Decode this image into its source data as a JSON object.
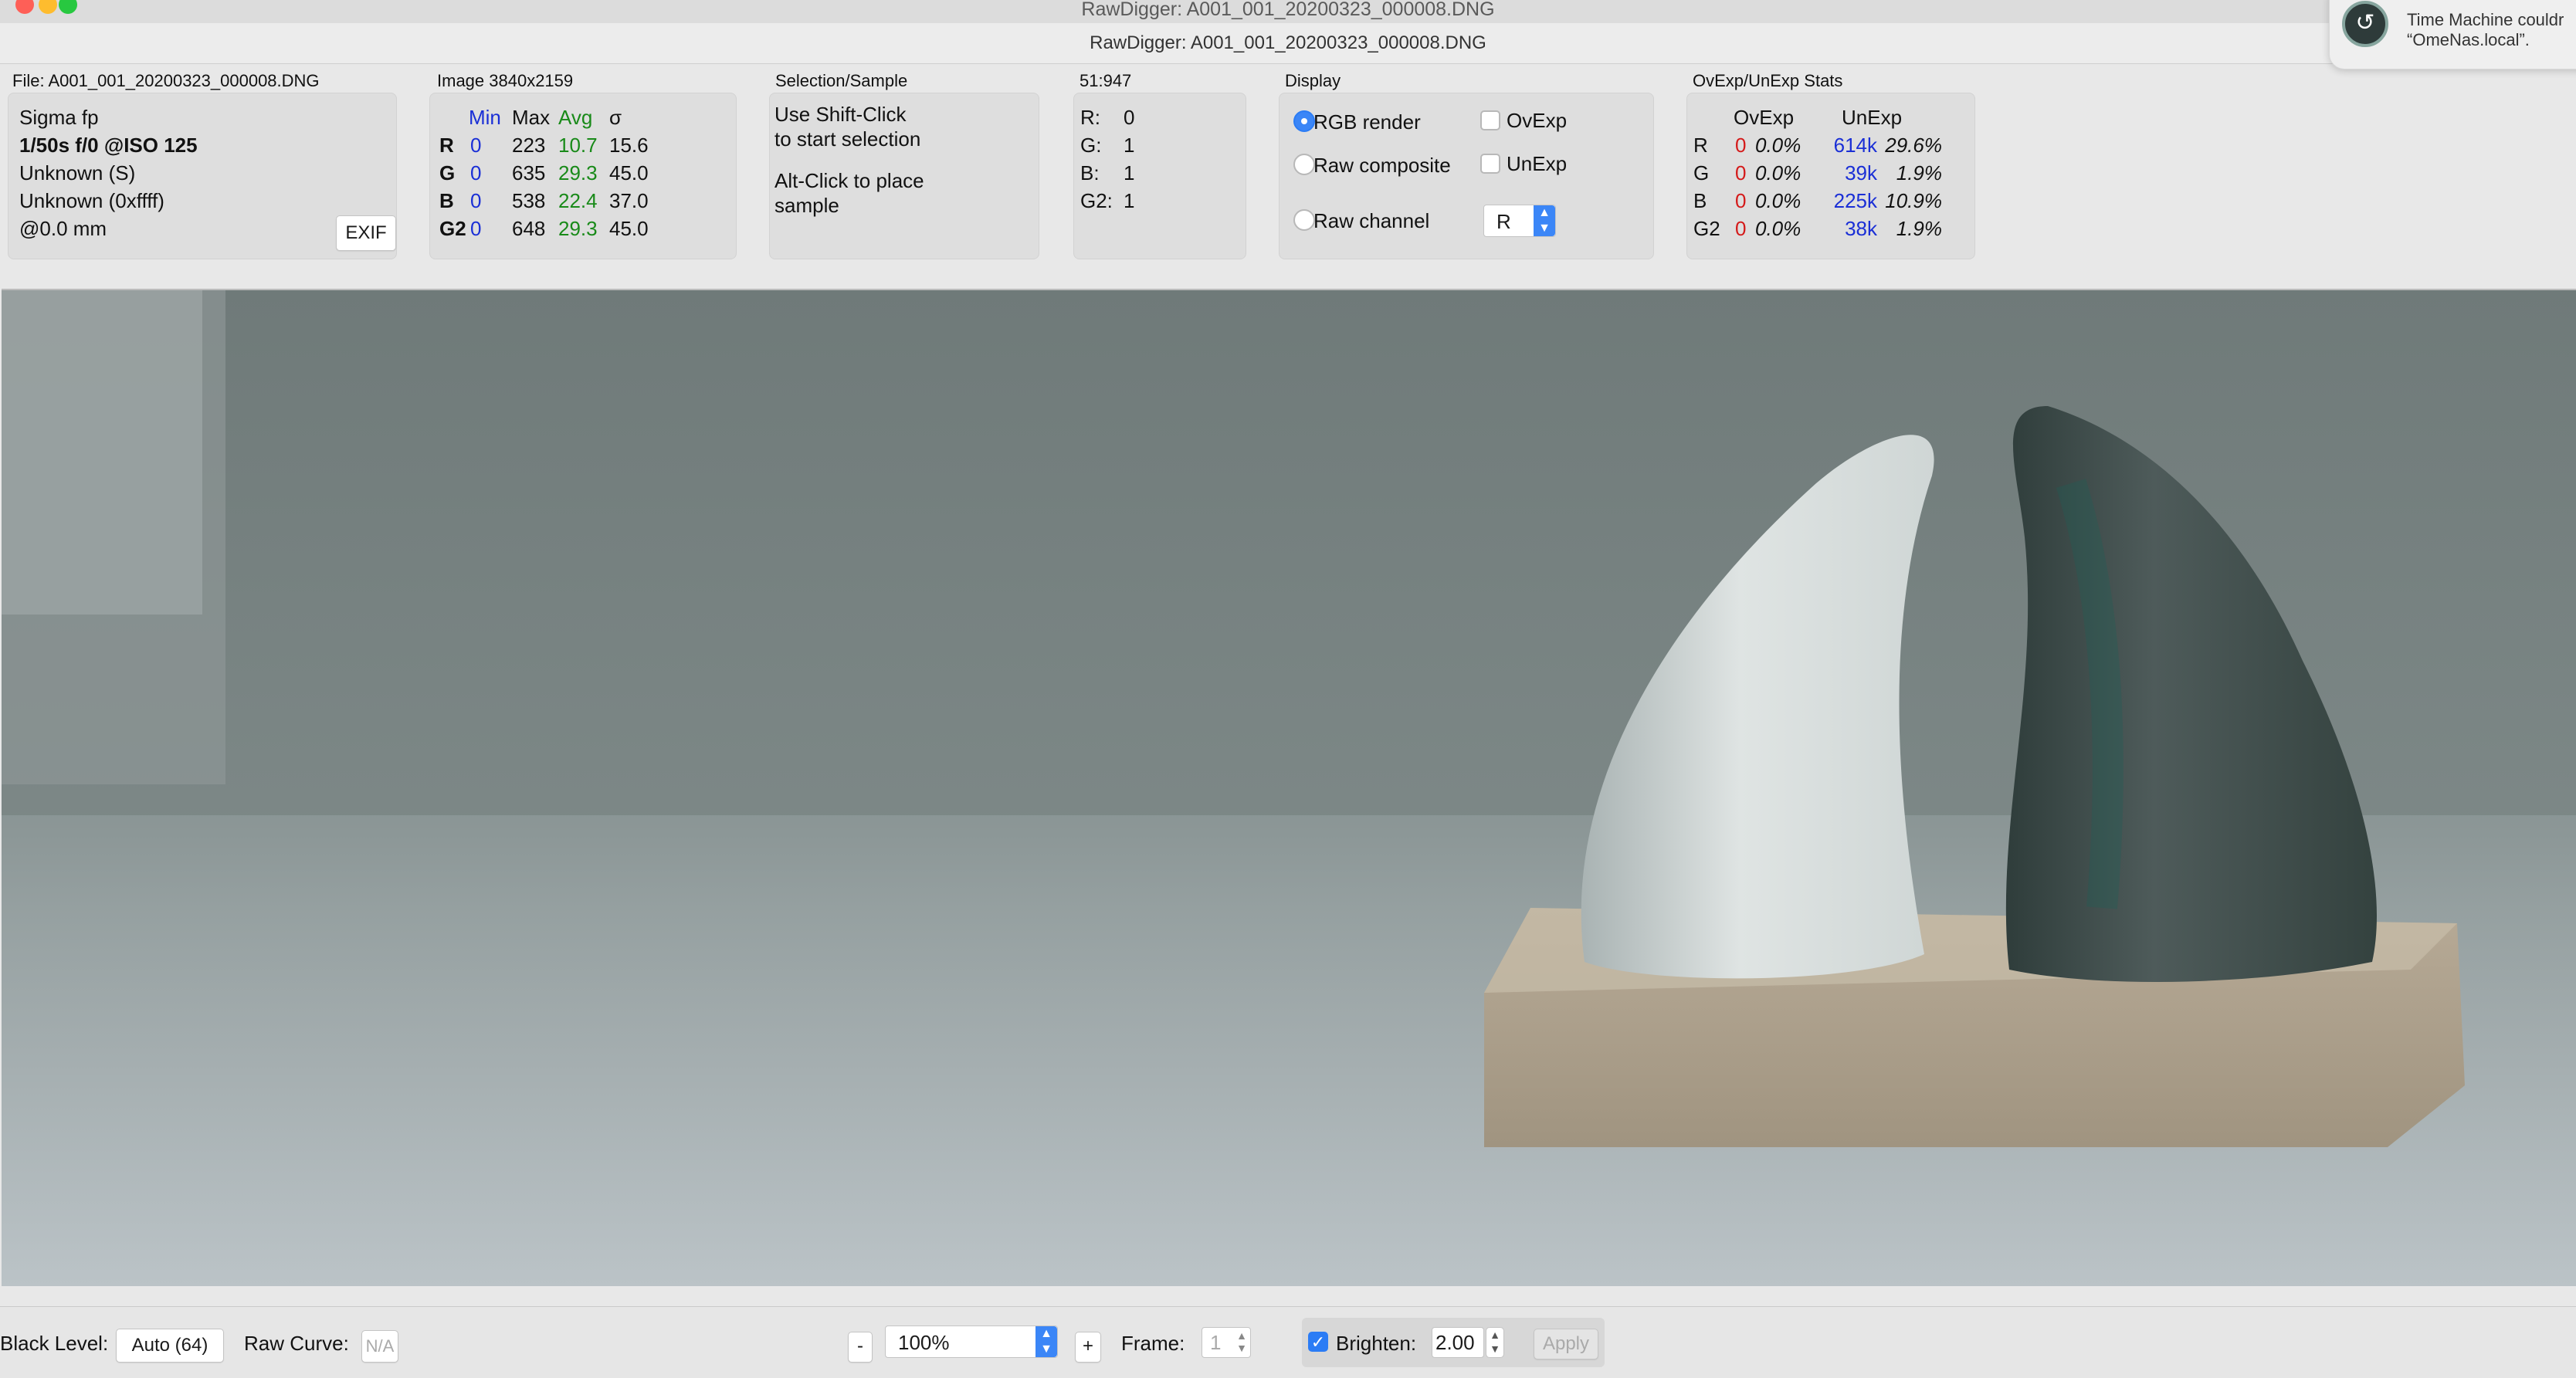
{
  "app": {
    "menubar_title": "RawDigger: A001_001_20200323_000008.DNG",
    "window_title": "RawDigger: A001_001_20200323_000008.DNG"
  },
  "notification": {
    "icon": "time-machine-icon",
    "line1": "Time Machine couldr",
    "line2": "“OmeNas.local”."
  },
  "file_panel": {
    "label": "File: A001_001_20200323_000008.DNG",
    "camera": "Sigma fp",
    "exposure": "1/50s f/0 @ISO 125",
    "lens1": "Unknown (S)",
    "lens2": "Unknown (0xffff)",
    "focal": "@0.0 mm",
    "exif_button": "EXIF"
  },
  "image_panel": {
    "label": "Image 3840x2159",
    "headers": {
      "min": "Min",
      "max": "Max",
      "avg": "Avg",
      "sigma": "σ"
    },
    "rows": [
      {
        "ch": "R",
        "min": "0",
        "max": "223",
        "avg": "10.7",
        "sigma": "15.6"
      },
      {
        "ch": "G",
        "min": "0",
        "max": "635",
        "avg": "29.3",
        "sigma": "45.0"
      },
      {
        "ch": "B",
        "min": "0",
        "max": "538",
        "avg": "22.4",
        "sigma": "37.0"
      },
      {
        "ch": "G2",
        "min": "0",
        "max": "648",
        "avg": "29.3",
        "sigma": "45.0"
      }
    ]
  },
  "selection_panel": {
    "label": "Selection/Sample",
    "line1": "Use Shift-Click",
    "line2": "to start selection",
    "line3": "Alt-Click to place",
    "line4": "sample"
  },
  "coord_panel": {
    "label": "51:947",
    "rows": [
      {
        "ch": "R:",
        "val": "0"
      },
      {
        "ch": "G:",
        "val": "1"
      },
      {
        "ch": "B:",
        "val": "1"
      },
      {
        "ch": "G2:",
        "val": "1"
      }
    ]
  },
  "display_panel": {
    "label": "Display",
    "rgb_render": "RGB render",
    "raw_composite": "Raw composite",
    "raw_channel": "Raw channel",
    "ovexp": "OvExp",
    "unexp": "UnExp",
    "channel_value": "R",
    "selected": "RGB render"
  },
  "stats_panel": {
    "label": "OvExp/UnExp Stats",
    "headers": {
      "ovexp": "OvExp",
      "unexp": "UnExp"
    },
    "rows": [
      {
        "ch": "R",
        "ov_count": "0",
        "ov_pct": "0.0%",
        "un_count": "614k",
        "un_pct": "29.6%"
      },
      {
        "ch": "G",
        "ov_count": "0",
        "ov_pct": "0.0%",
        "un_count": "39k",
        "un_pct": "1.9%"
      },
      {
        "ch": "B",
        "ov_count": "0",
        "ov_pct": "0.0%",
        "un_count": "225k",
        "un_pct": "10.9%"
      },
      {
        "ch": "G2",
        "ov_count": "0",
        "ov_pct": "0.0%",
        "un_count": "38k",
        "un_pct": "1.9%"
      }
    ]
  },
  "bottom_bar": {
    "black_level_label": "Black Level:",
    "black_level_value": "Auto (64)",
    "raw_curve_label": "Raw Curve:",
    "raw_curve_value": "N/A",
    "zoom_minus": "-",
    "zoom_value": "100%",
    "zoom_plus": "+",
    "frame_label": "Frame:",
    "frame_value": "1",
    "brighten_label": "Brighten:",
    "brighten_checked": true,
    "brighten_value": "2.00",
    "apply_button": "Apply"
  },
  "colors": {
    "accent_blue": "#2b7cf5",
    "min_blue": "#1a2fd6",
    "avg_green": "#198a19",
    "ov_red": "#d41a1a"
  }
}
